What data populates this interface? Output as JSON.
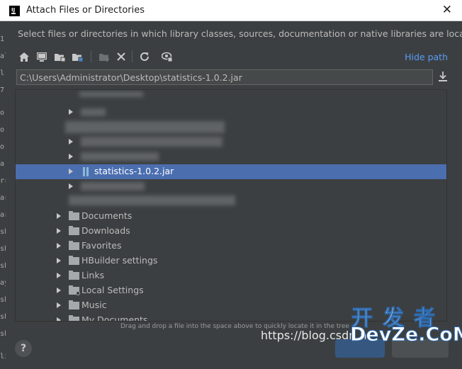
{
  "window": {
    "title": "Attach Files or Directories",
    "close_glyph": "✕"
  },
  "description": "Select files or directories in which library classes, sources, documentation or native libraries are located",
  "toolbar": {
    "icons": [
      "home-icon",
      "desktop-icon",
      "project-folder-icon",
      "module-folder-icon",
      "new-folder-icon",
      "delete-icon",
      "refresh-icon",
      "show-hidden-icon"
    ],
    "hide_path": "Hide path"
  },
  "path_field": {
    "value": "C:\\Users\\Administrator\\Desktop\\statistics-1.0.2.jar"
  },
  "tree": {
    "selected": {
      "label": "statistics-1.0.2.jar"
    },
    "items": [
      {
        "label": "Documents"
      },
      {
        "label": "Downloads"
      },
      {
        "label": "Favorites"
      },
      {
        "label": "HBuilder settings"
      },
      {
        "label": "Links"
      },
      {
        "label": "Local Settings"
      },
      {
        "label": "Music"
      },
      {
        "label": "My Documents"
      }
    ]
  },
  "hint": "Drag and drop a file into the space above to quickly locate it in the tree",
  "help_label": "?",
  "watermark": {
    "url": "https://blog.csdn.n",
    "cn": "开发者",
    "en": "DevZe.CoM"
  },
  "left_strip": [
    "1",
    "ale",
    "l.",
    "7",
    "o",
    "o",
    "o",
    "a",
    "rri",
    "ar",
    "ar",
    "sh",
    "sh",
    "sh",
    "ay",
    "sh",
    "sh",
    "sh",
    "li."
  ],
  "colors": {
    "background": "#3c3f41",
    "selection": "#4b6eaf",
    "link": "#589df6",
    "text": "#bbbbbb"
  }
}
